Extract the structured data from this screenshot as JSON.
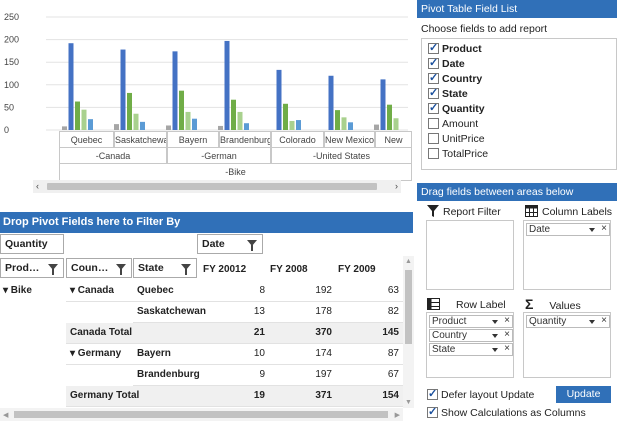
{
  "chart": {
    "type": "bar",
    "y_ticks": [
      "250",
      "200",
      "150",
      "100",
      "50",
      "0"
    ],
    "ylim": [
      0,
      250
    ],
    "categories": [
      "Quebec",
      "Saskatchewan",
      "Bayern",
      "Brandenburg",
      "Colorado",
      "New Mexico",
      "New"
    ],
    "countries": [
      {
        "label": "-Canada"
      },
      {
        "label": "-German"
      },
      {
        "label": "-United States"
      }
    ],
    "product_label": "-Bike",
    "series_colors": [
      "#a6a6a6",
      "#4472c4",
      "#70ad47",
      "#a9d18e",
      "#5b9bd5",
      "#2f5597"
    ],
    "groups": [
      [
        8,
        192,
        63,
        45,
        24
      ],
      [
        13,
        178,
        82,
        36,
        18
      ],
      [
        10,
        174,
        87,
        40,
        25
      ],
      [
        9,
        197,
        67,
        40,
        15
      ],
      [
        0,
        133,
        58,
        20,
        22
      ],
      [
        0,
        120,
        44,
        28,
        17
      ],
      [
        12,
        112,
        56,
        26,
        0
      ]
    ],
    "scroll_left": "‹",
    "scroll_right": "›"
  },
  "pivot": {
    "header": "Drop Pivot Fields here to Filter By",
    "data_field": "Quantity",
    "column_field": "Date",
    "row_fields": [
      "Prod…",
      "Coun…",
      "State"
    ],
    "columns": [
      "FY 20012",
      "FY 2008",
      "FY 2009"
    ],
    "rows": [
      {
        "product": "▾ Bike",
        "country": "▾ Canada",
        "state": "Quebec",
        "values": [
          "8",
          "192",
          "63"
        ],
        "total": false
      },
      {
        "product": "",
        "country": "",
        "state": "Saskatchewan",
        "values": [
          "13",
          "178",
          "82"
        ],
        "total": false
      },
      {
        "product": "",
        "country": "Canada Total",
        "state": "",
        "values": [
          "21",
          "370",
          "145"
        ],
        "total": true
      },
      {
        "product": "",
        "country": "▾ Germany",
        "state": "Bayern",
        "values": [
          "10",
          "174",
          "87"
        ],
        "total": false
      },
      {
        "product": "",
        "country": "",
        "state": "Brandenburg",
        "values": [
          "9",
          "197",
          "67"
        ],
        "total": false
      },
      {
        "product": "",
        "country": "Germany Total",
        "state": "",
        "values": [
          "19",
          "371",
          "154"
        ],
        "total": true
      }
    ]
  },
  "panel": {
    "title": "Pivot Table Field List",
    "choose_label": "Choose fields to add report",
    "fields": [
      {
        "label": "Product",
        "checked": true
      },
      {
        "label": "Date",
        "checked": true
      },
      {
        "label": "Country",
        "checked": true
      },
      {
        "label": "State",
        "checked": true
      },
      {
        "label": "Quantity",
        "checked": true
      },
      {
        "label": "Amount",
        "checked": false
      },
      {
        "label": "UnitPrice",
        "checked": false
      },
      {
        "label": "TotalPrice",
        "checked": false
      }
    ],
    "drag_title": "Drag fields between areas below",
    "report_filter": "Report Filter",
    "column_labels": "Column Labels",
    "column_items": [
      "Date"
    ],
    "row_label": "Row Label",
    "values_label": "Values",
    "row_items": [
      "Product",
      "Country",
      "State"
    ],
    "value_items": [
      "Quantity"
    ],
    "defer_label": "Defer layout Update",
    "update_label": "Update",
    "show_calc_label": "Show Calculations as Columns"
  }
}
